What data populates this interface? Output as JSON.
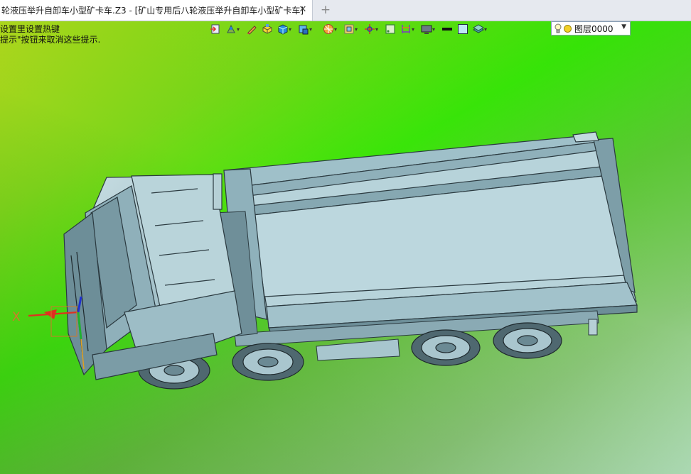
{
  "tab": {
    "title": "轮液压举升自卸车小型矿卡车.Z3 - [矿山专用后八轮液压举升自卸车小型矿卡车]",
    "close_glyph": "✕",
    "add_glyph": "+"
  },
  "hints": {
    "line1": "设置里设置热键",
    "line2": "提示\"按钮来取消这些提示."
  },
  "toolbar": {
    "icons": [
      "import-icon",
      "drape-icon",
      "pen-icon",
      "solid-yellow-icon",
      "cube-blue-icon",
      "cube-view-icon",
      "shading-icon",
      "frame-icon",
      "pivot-icon",
      "snap-square-icon",
      "dimension-icon",
      "display-icon",
      "black-line-icon",
      "color-square-icon",
      "layer-stack-icon"
    ]
  },
  "layer": {
    "name": "图层0000",
    "arrow": "▼"
  },
  "axis": {
    "x_label": "X"
  },
  "colors": {
    "truck_body": "#a9c8d0",
    "truck_dark": "#5f7e88",
    "truck_line": "#2b3a40",
    "axis_x": "#e03020",
    "axis_y": "#20b030",
    "axis_z": "#2030d0"
  }
}
